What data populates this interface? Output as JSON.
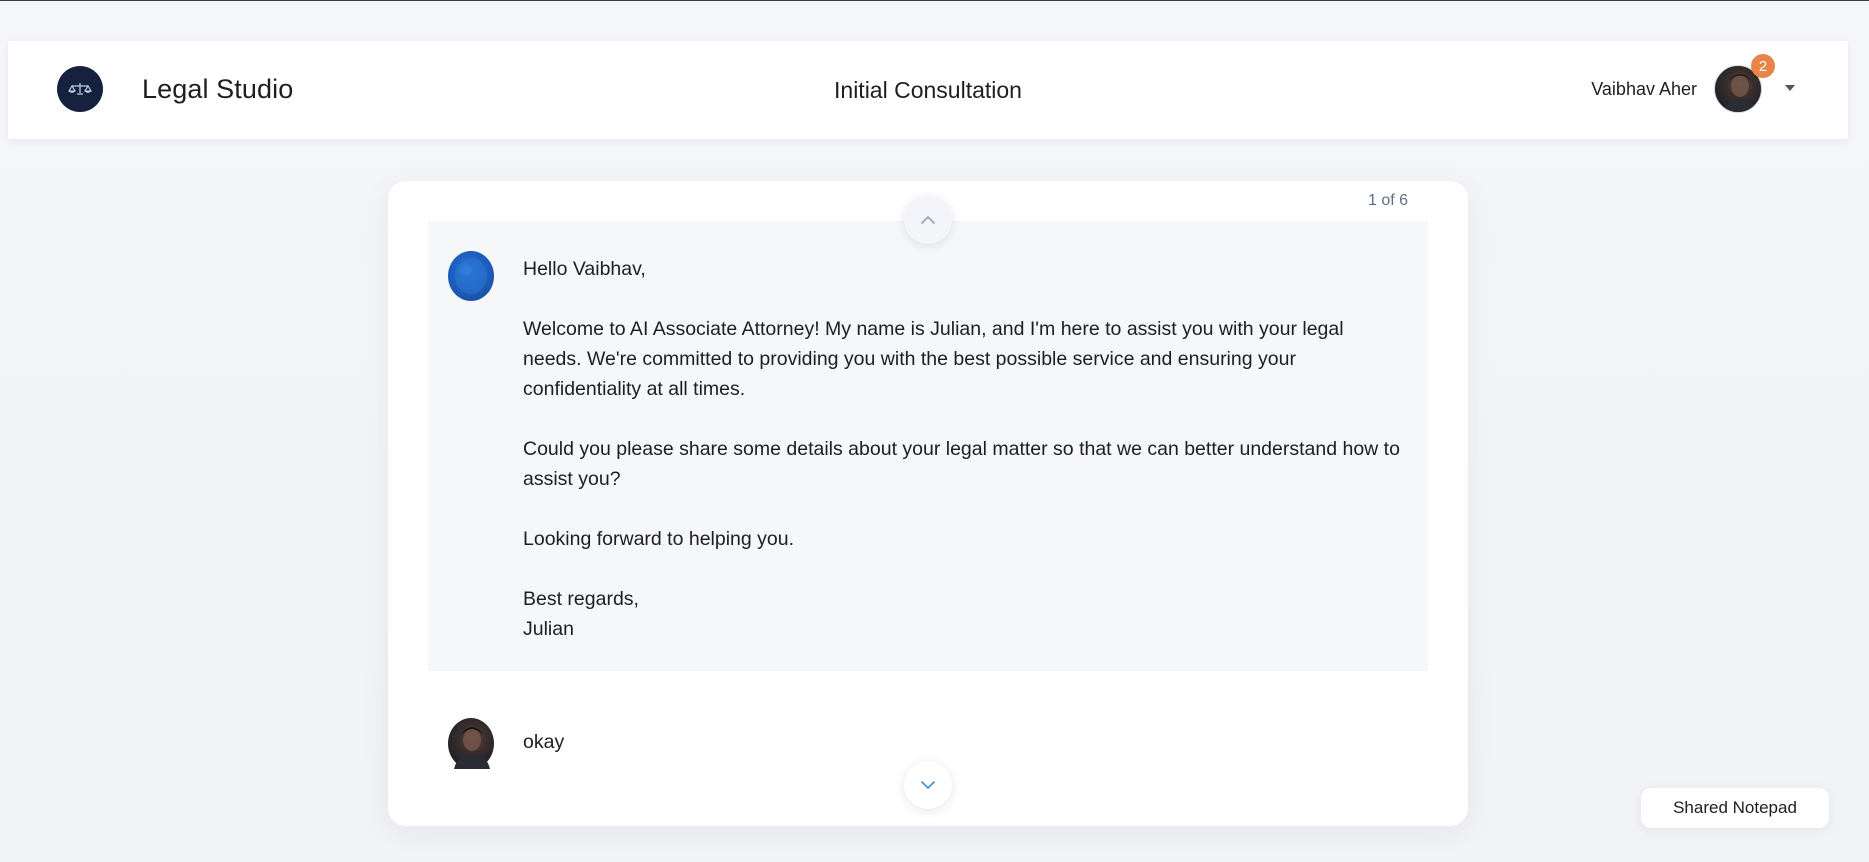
{
  "header": {
    "app_title": "Legal Studio",
    "page_title": "Initial Consultation",
    "user_name": "Vaibhav Aher",
    "notification_count": "2",
    "logo_icon": "scales-of-justice-icon"
  },
  "chat": {
    "counter": "1 of 6",
    "messages": [
      {
        "sender": "ai",
        "text": "Hello Vaibhav,\n\nWelcome to AI Associate Attorney! My name is Julian, and I'm here to assist you with your legal needs. We're committed to providing you with the best possible service and ensuring your confidentiality at all times.\n\nCould you please share some details about your legal matter so that we can better understand how to assist you?\n\nLooking forward to helping you.\n\nBest regards,\nJulian"
      },
      {
        "sender": "user",
        "text": "okay"
      }
    ]
  },
  "notepad": {
    "label": "Shared Notepad"
  },
  "colors": {
    "logo_bg": "#15213d",
    "badge": "#e8844a",
    "ai_avatar": "#1e5fbe",
    "message_bg": "#f6f7f9",
    "counter_text": "#5f6f85"
  }
}
